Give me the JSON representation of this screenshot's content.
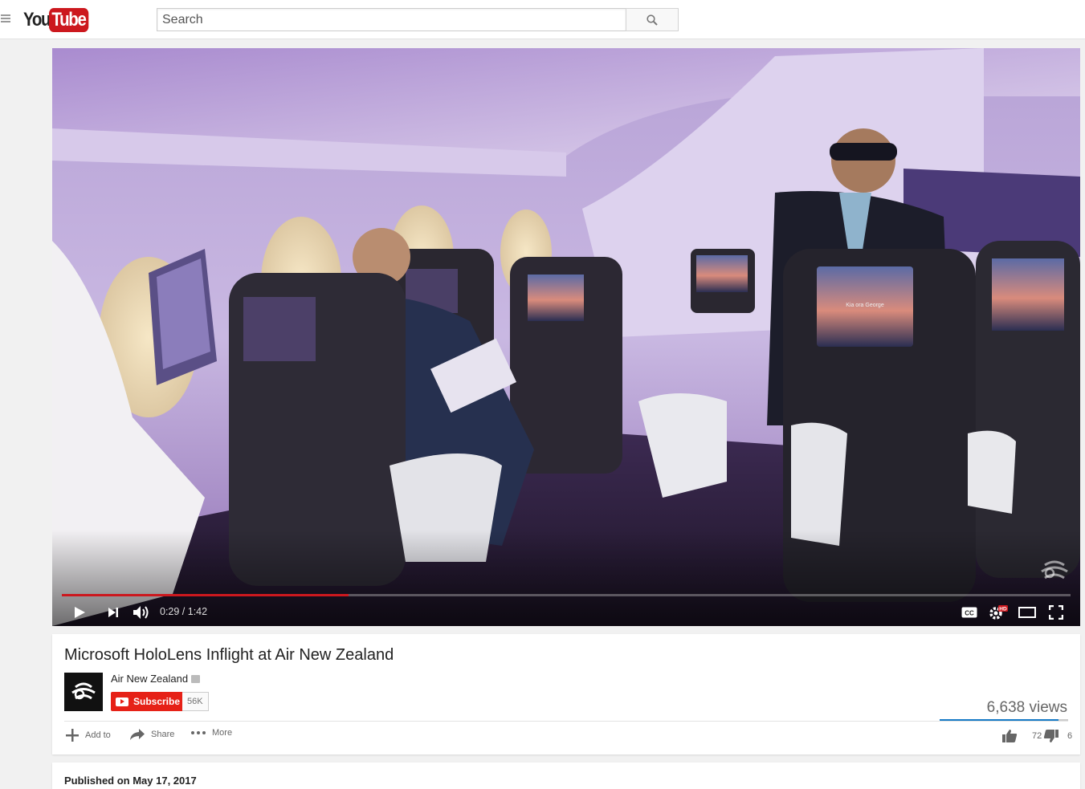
{
  "masthead": {
    "logo_you": "You",
    "logo_tube": "Tube",
    "search_placeholder": "Search"
  },
  "player": {
    "current_time": "0:29",
    "duration": "1:42",
    "time_display": "0:29 / 1:42",
    "progress_fraction": 0.284,
    "screen_text": "Kia ora George",
    "icons": [
      "play-icon",
      "next-icon",
      "volume-icon",
      "captions-icon",
      "settings-hd-icon",
      "theater-icon",
      "fullscreen-icon"
    ],
    "accent_color": "#cc181e"
  },
  "video": {
    "title": "Microsoft HoloLens Inflight at Air New Zealand",
    "channel_name": "Air New Zealand",
    "subscribe_label": "Subscribe",
    "subscriber_count": "56K",
    "views": "6,638 views",
    "actions": {
      "add_to": "Add to",
      "share": "Share",
      "more": "More"
    },
    "likes": "72",
    "dislikes": "6",
    "like_fraction": 0.923
  },
  "description": {
    "published": "Published on May 17, 2017"
  }
}
